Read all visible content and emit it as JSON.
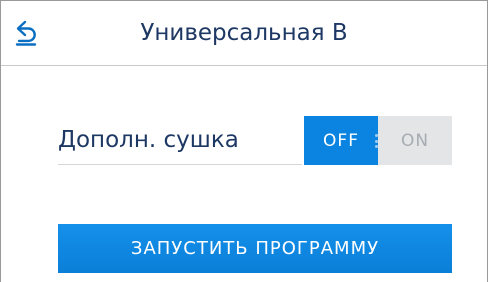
{
  "header": {
    "title": "Универсальная B",
    "back_icon": "back-arrow-icon"
  },
  "settings": {
    "extra_drying": {
      "label": "Дополн. сушка",
      "off_label": "OFF",
      "on_label": "ON",
      "state": "OFF"
    }
  },
  "actions": {
    "start_label": "ЗАПУСТИТЬ ПРОГРАММУ"
  },
  "colors": {
    "accent": "#0a84e0",
    "text": "#1e3864",
    "inactive_bg": "#e4e5e6",
    "inactive_text": "#a6acb3"
  }
}
